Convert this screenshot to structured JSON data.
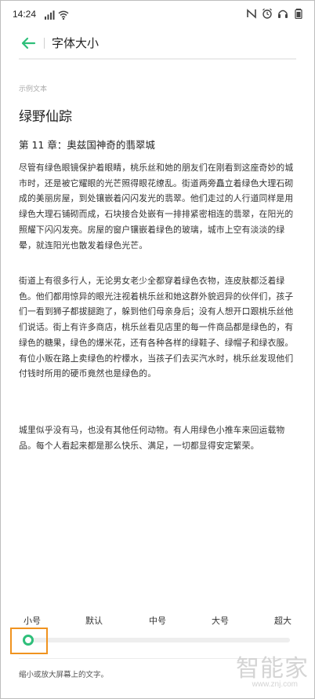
{
  "status_bar": {
    "time": "14:24",
    "left_icons": [
      "signal-icon",
      "wifi-icon"
    ],
    "right_icons": [
      "nfc-icon",
      "alarm-icon",
      "headphones-icon",
      "battery-icon"
    ]
  },
  "app_bar": {
    "title": "字体大小",
    "back_icon": "arrow-left-icon",
    "accent_color": "#2fbf7a"
  },
  "sample": {
    "label": "示例文本",
    "heading": "绿野仙踪",
    "chapter": "第 11 章：奥兹国神奇的翡翠城",
    "paragraphs": [
      "尽管有绿色眼镜保护着眼睛，桃乐丝和她的朋友们在刚看到这座奇妙的城市时，还是被它耀眼的光芒照得眼花缭乱。街道两旁矗立着绿色大理石砌成的美丽房屋，到处镶嵌着闪闪发光的翡翠。他们走过的人行道同样是用绿色大理石铺砌而成，石块接合处嵌有一排排紧密相连的翡翠，在阳光的照耀下闪闪发亮。房屋的窗户镶嵌着绿色的玻璃，城市上空有淡淡的绿晕，就连阳光也散发着绿色光芒。",
      "街道上有很多行人，无论男女老少全都穿着绿色衣物，连皮肤都泛着绿色。他们都用惊异的眼光注视着桃乐丝和她这群外貌迥异的伙伴们，孩子们一看到狮子都拔腿跑了，躲到他们母亲身后；没有人想开口跟桃乐丝他们说话。街上有许多商店，桃乐丝看见店里的每一件商品都是绿色的，有绿色的糖果，绿色的爆米花，还有各种各样的绿鞋子、绿帽子和绿衣服。有位小贩在路上卖绿色的柠檬水，当孩子们去买汽水时，桃乐丝发现他们付钱时所用的硬币竟然也是绿色的。",
      "城里似乎没有马，也没有其他任何动物。有人用绿色小推车来回运载物品。每个人看起来都是那么快乐、满足，一切都显得安定繁荣。"
    ]
  },
  "font_size": {
    "options": [
      "小号",
      "默认",
      "中号",
      "大号",
      "超大"
    ],
    "selected": "小号",
    "selected_index": 0,
    "hint": "缩小或放大屏幕上的文字。",
    "highlight_color": "#f0931f"
  },
  "watermark": {
    "text": "智能家",
    "url": "www.znj.com"
  }
}
